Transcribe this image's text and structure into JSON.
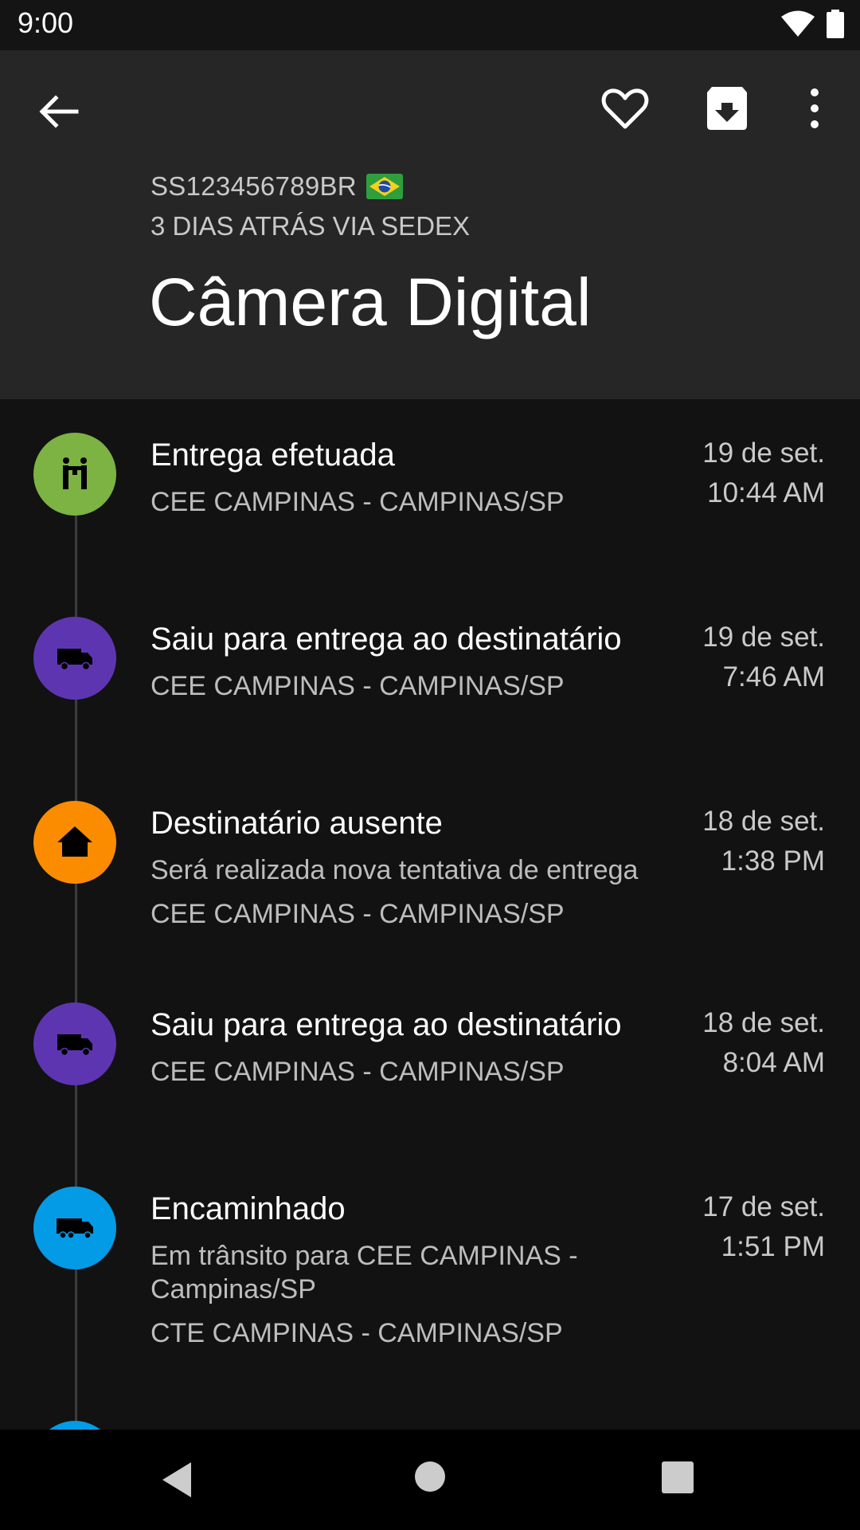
{
  "status_bar": {
    "time": "9:00"
  },
  "header": {
    "tracking_code": "SS123456789BR",
    "shipping_info": "3 DIAS ATRÁS VIA SEDEX",
    "title": "Câmera Digital"
  },
  "colors": {
    "delivered": "#7cb342",
    "out_for_delivery": "#5e35b1",
    "absent": "#fb8c00",
    "forwarded": "#039be5"
  },
  "events": [
    {
      "title": "Entrega efetuada",
      "details": [
        "CEE CAMPINAS - CAMPINAS/SP"
      ],
      "date": "19 de set.",
      "time": "10:44 AM",
      "icon": "hand-over-icon"
    },
    {
      "title": "Saiu para entrega ao destinatário",
      "details": [
        "CEE CAMPINAS - CAMPINAS/SP"
      ],
      "date": "19 de set.",
      "time": "7:46 AM",
      "icon": "van-icon"
    },
    {
      "title": "Destinatário ausente",
      "details": [
        "Será realizada nova tentativa de entrega",
        "CEE CAMPINAS - CAMPINAS/SP"
      ],
      "date": "18 de set.",
      "time": "1:38 PM",
      "icon": "home-icon"
    },
    {
      "title": "Saiu para entrega ao destinatário",
      "details": [
        "CEE CAMPINAS - CAMPINAS/SP"
      ],
      "date": "18 de set.",
      "time": "8:04 AM",
      "icon": "van-icon"
    },
    {
      "title": "Encaminhado",
      "details": [
        "Em trânsito para CEE CAMPINAS - Campinas/SP",
        "CTE CAMPINAS - CAMPINAS/SP"
      ],
      "date": "17 de set.",
      "time": "1:51 PM",
      "icon": "truck-icon"
    }
  ]
}
